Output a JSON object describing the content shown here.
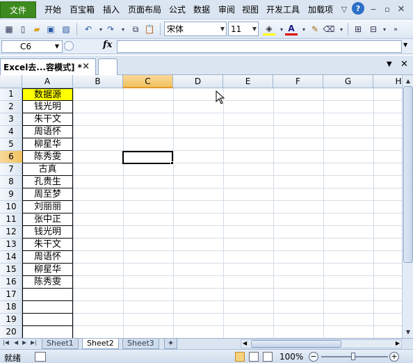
{
  "menu": {
    "file": "文件",
    "items": [
      "开始",
      "百宝箱",
      "插入",
      "页面布局",
      "公式",
      "数据",
      "审阅",
      "视图",
      "开发工具",
      "加载项"
    ]
  },
  "toolbar": {
    "font_name": "宋体",
    "font_size": "11",
    "icons": [
      "excel-icon",
      "new-icon",
      "open-icon",
      "save-icon",
      "save-as-icon",
      "undo-icon",
      "redo-icon",
      "copy-icon",
      "paste-icon",
      "fill-color-icon",
      "font-color-icon",
      "format-painter-icon",
      "clear-icon",
      "borders-icon",
      "merge-icon",
      "more-icon"
    ]
  },
  "formula_bar": {
    "name_box": "C6",
    "fx": "fx",
    "formula": ""
  },
  "doc_tab": {
    "title": "Excel去...容模式] *",
    "close": "×"
  },
  "columns": [
    "A",
    "B",
    "C",
    "D",
    "E",
    "F",
    "G",
    "H"
  ],
  "active_column": "C",
  "rows": [
    "1",
    "2",
    "3",
    "4",
    "5",
    "6",
    "7",
    "8",
    "9",
    "10",
    "11",
    "12",
    "13",
    "14",
    "15",
    "16",
    "17",
    "18",
    "19",
    "20"
  ],
  "active_row": "6",
  "column_a": [
    "数据源",
    "钱光明",
    "朱干文",
    "周语怀",
    "柳星华",
    "陈秀雯",
    "古真",
    "孔贵生",
    "周至梦",
    "刘丽丽",
    "张中正",
    "钱光明",
    "朱干文",
    "周语怀",
    "柳星华",
    "陈秀雯",
    "",
    "",
    "",
    ""
  ],
  "sheets": [
    "Sheet1",
    "Sheet2",
    "Sheet3"
  ],
  "active_sheet": "Sheet2",
  "status": {
    "ready": "就绪",
    "zoom": "100%"
  },
  "colors": {
    "file_button": "#3d8b1e",
    "header_highlight": "#f1c15f",
    "title_cell_fill": "#ffff00"
  }
}
